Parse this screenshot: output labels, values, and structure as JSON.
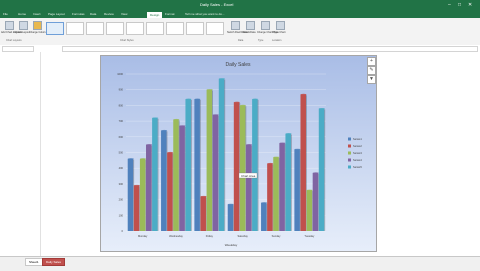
{
  "window": {
    "title": "Daily Sales - Excel",
    "controls": [
      "minimize-icon",
      "restore-icon",
      "close-icon"
    ]
  },
  "ribbon": {
    "tabs": [
      "File",
      "Home",
      "Insert",
      "Page Layout",
      "Formulas",
      "Data",
      "Review",
      "View",
      "Design",
      "Format"
    ],
    "active_tab": "Design",
    "tell_me": "Tell me what you want to do...",
    "groups": [
      "Chart Layouts",
      "Chart Styles",
      "Data",
      "Type",
      "Location"
    ],
    "buttons": [
      "Add Chart Element",
      "Quick Layout",
      "Change Colors",
      "Switch Row/Column",
      "Select Data",
      "Change Chart Type",
      "Move Chart"
    ]
  },
  "sheet_tabs": [
    "Sheet1",
    "Daily Sales"
  ],
  "chart_data": {
    "type": "bar",
    "title": "Daily Sales",
    "categories": [
      "Monday",
      "Wednesday",
      "Friday",
      "Saturday",
      "Sunday",
      "Tuesday"
    ],
    "ylim": [
      0,
      1000
    ],
    "yticks": [
      0,
      100,
      200,
      300,
      400,
      500,
      600,
      700,
      800,
      900,
      1000
    ],
    "series": [
      {
        "name": "Series1",
        "color": "#4f81bd",
        "values": [
          460,
          640,
          840,
          170,
          180,
          520
        ]
      },
      {
        "name": "Series2",
        "color": "#c0504d",
        "values": [
          290,
          500,
          220,
          820,
          430,
          870
        ]
      },
      {
        "name": "Series3",
        "color": "#9bbb59",
        "values": [
          460,
          710,
          900,
          800,
          470,
          260
        ]
      },
      {
        "name": "Series4",
        "color": "#8064a2",
        "values": [
          550,
          670,
          740,
          550,
          560,
          370
        ]
      },
      {
        "name": "Series5",
        "color": "#4bacc6",
        "values": [
          720,
          840,
          970,
          840,
          620,
          780
        ]
      }
    ],
    "legend_position": "right",
    "x_axis_title": "Weekday",
    "tooltip": "Chart Area"
  },
  "colors": {
    "excel_green": "#217346",
    "chart_bg_top": "#a9bde6",
    "chart_bg_bottom": "#e7eefa"
  }
}
